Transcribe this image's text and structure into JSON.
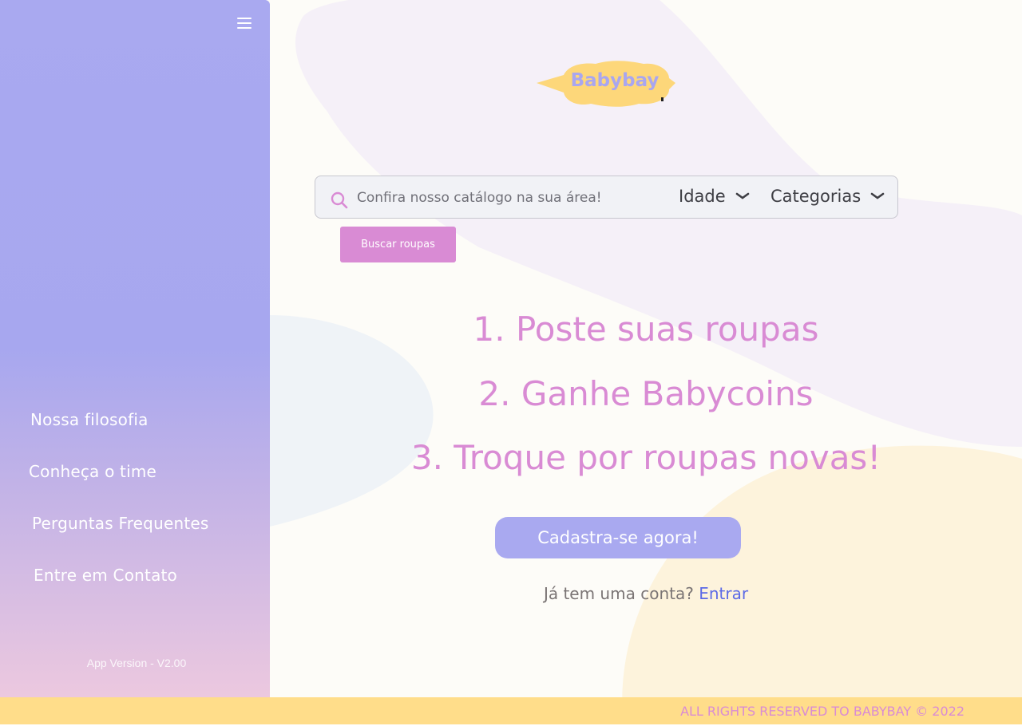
{
  "sidebar": {
    "menu_icon": "hamburger-menu-icon",
    "items": [
      {
        "label": "Nossa filosofia"
      },
      {
        "label": "Conheça o time"
      },
      {
        "label": "Perguntas Frequentes"
      },
      {
        "label": "Entre em Contato"
      }
    ],
    "version": "App Version - V2.00"
  },
  "logo": {
    "text": "Babybay"
  },
  "search": {
    "icon": "search-icon",
    "placeholder": "Confira nosso catálogo na sua área!",
    "value": "",
    "age_label": "Idade",
    "categories_label": "Categorias",
    "button_label": "Buscar roupas"
  },
  "steps": [
    {
      "text": "1. Poste suas roupas"
    },
    {
      "text": "2. Ganhe Babycoins"
    },
    {
      "text": "3. Troque por roupas novas!"
    }
  ],
  "cta": {
    "label": "Cadastra-se agora!"
  },
  "login": {
    "prompt": "Já tem uma conta?",
    "link": "Entrar"
  },
  "footer": {
    "text": "ALL RIGHTS RESERVED TO BABYBAY © 2022"
  },
  "colors": {
    "primary": "#a9a9f0",
    "accent_pink": "#d98bd4",
    "footer_yellow": "#ffdd8a",
    "link": "#5c6ae6",
    "background": "#fdfcf8"
  }
}
